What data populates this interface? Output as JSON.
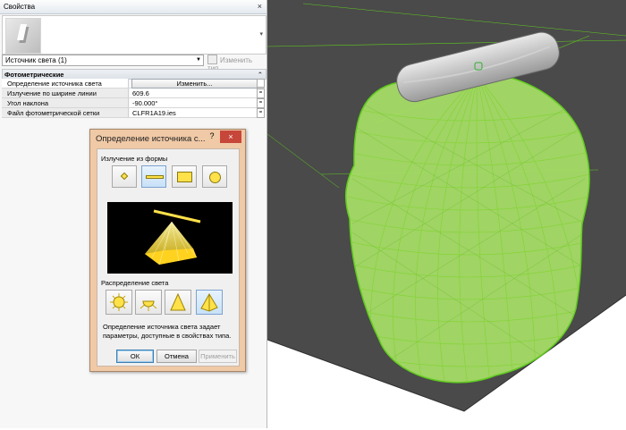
{
  "properties": {
    "title": "Свойства",
    "close_glyph": "×",
    "type_icon": "light-fixture-type-icon",
    "instance_selector": "Источник света (1)",
    "edit_type_label": "Изменить тип",
    "group_title": "Фотометрические",
    "rows": [
      {
        "label": "Определение источника света",
        "value": "Изменить..."
      },
      {
        "label": "Излучение по ширине линии",
        "value": "609.6"
      },
      {
        "label": "Угол наклона",
        "value": "-90.000°"
      },
      {
        "label": "Файл фотометрической сетки",
        "value": "CLFR1A19.ies"
      }
    ]
  },
  "dialog": {
    "title": "Определение источника с...",
    "help_glyph": "?",
    "close_glyph": "×",
    "emit_section": "Излучение из формы",
    "shape_icons": [
      "point-icon",
      "line-icon",
      "rectangle-icon",
      "circle-icon"
    ],
    "distribution_section": "Распределение света",
    "distribution_icons": [
      "spherical-icon",
      "hemispherical-icon",
      "spot-icon",
      "photometric-web-icon"
    ],
    "description": "Определение источника света задает параметры, доступные в свойствах типа.",
    "ok_label": "ОК",
    "cancel_label": "Отмена",
    "apply_label": "Применить"
  },
  "colors": {
    "wire_green": "#5fcb1e",
    "wire_fill": "#a7e066",
    "dark_background": "#4a4a4a",
    "dialog_frame": "#f0c9a6",
    "close_red": "#c7463a",
    "selected_blue": "#c8e1f8",
    "light_yellow": "#ffe14a"
  }
}
